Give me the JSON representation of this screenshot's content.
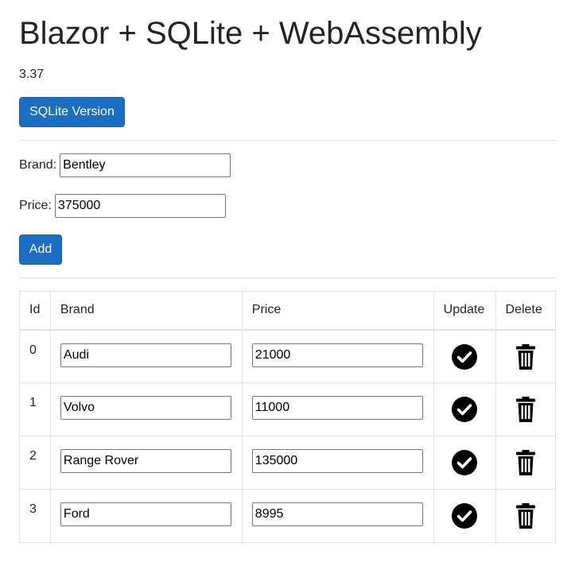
{
  "header": {
    "title": "Blazor + SQLite + WebAssembly",
    "version_text": "3.37",
    "version_button_label": "SQLite Version"
  },
  "form": {
    "brand_label": "Brand:",
    "brand_value": "Bentley",
    "price_label": "Price:",
    "price_value": "375000",
    "add_label": "Add"
  },
  "table": {
    "headers": {
      "id": "Id",
      "brand": "Brand",
      "price": "Price",
      "update": "Update",
      "delete": "Delete"
    },
    "rows": [
      {
        "id": "0",
        "brand": "Audi",
        "price": "21000"
      },
      {
        "id": "1",
        "brand": "Volvo",
        "price": "11000"
      },
      {
        "id": "2",
        "brand": "Range Rover",
        "price": "135000"
      },
      {
        "id": "3",
        "brand": "Ford",
        "price": "8995"
      }
    ],
    "update_icon": "check-circle-icon",
    "delete_icon": "trash-icon"
  },
  "colors": {
    "primary_button": "#1b6ec2",
    "border": "#dee2e6",
    "text": "#212529"
  }
}
